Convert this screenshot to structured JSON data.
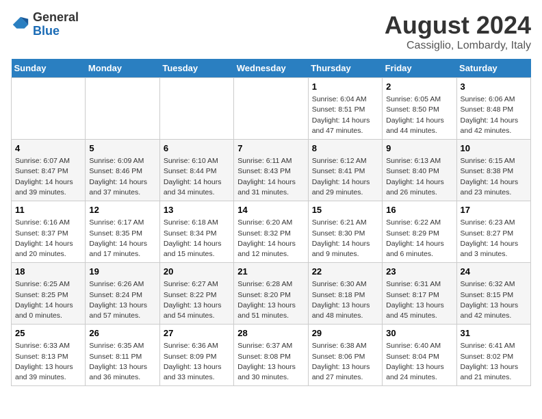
{
  "logo": {
    "general": "General",
    "blue": "Blue"
  },
  "title": "August 2024",
  "subtitle": "Cassiglio, Lombardy, Italy",
  "days_header": [
    "Sunday",
    "Monday",
    "Tuesday",
    "Wednesday",
    "Thursday",
    "Friday",
    "Saturday"
  ],
  "weeks": [
    [
      {
        "day": "",
        "info": ""
      },
      {
        "day": "",
        "info": ""
      },
      {
        "day": "",
        "info": ""
      },
      {
        "day": "",
        "info": ""
      },
      {
        "day": "1",
        "info": "Sunrise: 6:04 AM\nSunset: 8:51 PM\nDaylight: 14 hours and 47 minutes."
      },
      {
        "day": "2",
        "info": "Sunrise: 6:05 AM\nSunset: 8:50 PM\nDaylight: 14 hours and 44 minutes."
      },
      {
        "day": "3",
        "info": "Sunrise: 6:06 AM\nSunset: 8:48 PM\nDaylight: 14 hours and 42 minutes."
      }
    ],
    [
      {
        "day": "4",
        "info": "Sunrise: 6:07 AM\nSunset: 8:47 PM\nDaylight: 14 hours and 39 minutes."
      },
      {
        "day": "5",
        "info": "Sunrise: 6:09 AM\nSunset: 8:46 PM\nDaylight: 14 hours and 37 minutes."
      },
      {
        "day": "6",
        "info": "Sunrise: 6:10 AM\nSunset: 8:44 PM\nDaylight: 14 hours and 34 minutes."
      },
      {
        "day": "7",
        "info": "Sunrise: 6:11 AM\nSunset: 8:43 PM\nDaylight: 14 hours and 31 minutes."
      },
      {
        "day": "8",
        "info": "Sunrise: 6:12 AM\nSunset: 8:41 PM\nDaylight: 14 hours and 29 minutes."
      },
      {
        "day": "9",
        "info": "Sunrise: 6:13 AM\nSunset: 8:40 PM\nDaylight: 14 hours and 26 minutes."
      },
      {
        "day": "10",
        "info": "Sunrise: 6:15 AM\nSunset: 8:38 PM\nDaylight: 14 hours and 23 minutes."
      }
    ],
    [
      {
        "day": "11",
        "info": "Sunrise: 6:16 AM\nSunset: 8:37 PM\nDaylight: 14 hours and 20 minutes."
      },
      {
        "day": "12",
        "info": "Sunrise: 6:17 AM\nSunset: 8:35 PM\nDaylight: 14 hours and 17 minutes."
      },
      {
        "day": "13",
        "info": "Sunrise: 6:18 AM\nSunset: 8:34 PM\nDaylight: 14 hours and 15 minutes."
      },
      {
        "day": "14",
        "info": "Sunrise: 6:20 AM\nSunset: 8:32 PM\nDaylight: 14 hours and 12 minutes."
      },
      {
        "day": "15",
        "info": "Sunrise: 6:21 AM\nSunset: 8:30 PM\nDaylight: 14 hours and 9 minutes."
      },
      {
        "day": "16",
        "info": "Sunrise: 6:22 AM\nSunset: 8:29 PM\nDaylight: 14 hours and 6 minutes."
      },
      {
        "day": "17",
        "info": "Sunrise: 6:23 AM\nSunset: 8:27 PM\nDaylight: 14 hours and 3 minutes."
      }
    ],
    [
      {
        "day": "18",
        "info": "Sunrise: 6:25 AM\nSunset: 8:25 PM\nDaylight: 14 hours and 0 minutes."
      },
      {
        "day": "19",
        "info": "Sunrise: 6:26 AM\nSunset: 8:24 PM\nDaylight: 13 hours and 57 minutes."
      },
      {
        "day": "20",
        "info": "Sunrise: 6:27 AM\nSunset: 8:22 PM\nDaylight: 13 hours and 54 minutes."
      },
      {
        "day": "21",
        "info": "Sunrise: 6:28 AM\nSunset: 8:20 PM\nDaylight: 13 hours and 51 minutes."
      },
      {
        "day": "22",
        "info": "Sunrise: 6:30 AM\nSunset: 8:18 PM\nDaylight: 13 hours and 48 minutes."
      },
      {
        "day": "23",
        "info": "Sunrise: 6:31 AM\nSunset: 8:17 PM\nDaylight: 13 hours and 45 minutes."
      },
      {
        "day": "24",
        "info": "Sunrise: 6:32 AM\nSunset: 8:15 PM\nDaylight: 13 hours and 42 minutes."
      }
    ],
    [
      {
        "day": "25",
        "info": "Sunrise: 6:33 AM\nSunset: 8:13 PM\nDaylight: 13 hours and 39 minutes."
      },
      {
        "day": "26",
        "info": "Sunrise: 6:35 AM\nSunset: 8:11 PM\nDaylight: 13 hours and 36 minutes."
      },
      {
        "day": "27",
        "info": "Sunrise: 6:36 AM\nSunset: 8:09 PM\nDaylight: 13 hours and 33 minutes."
      },
      {
        "day": "28",
        "info": "Sunrise: 6:37 AM\nSunset: 8:08 PM\nDaylight: 13 hours and 30 minutes."
      },
      {
        "day": "29",
        "info": "Sunrise: 6:38 AM\nSunset: 8:06 PM\nDaylight: 13 hours and 27 minutes."
      },
      {
        "day": "30",
        "info": "Sunrise: 6:40 AM\nSunset: 8:04 PM\nDaylight: 13 hours and 24 minutes."
      },
      {
        "day": "31",
        "info": "Sunrise: 6:41 AM\nSunset: 8:02 PM\nDaylight: 13 hours and 21 minutes."
      }
    ]
  ]
}
